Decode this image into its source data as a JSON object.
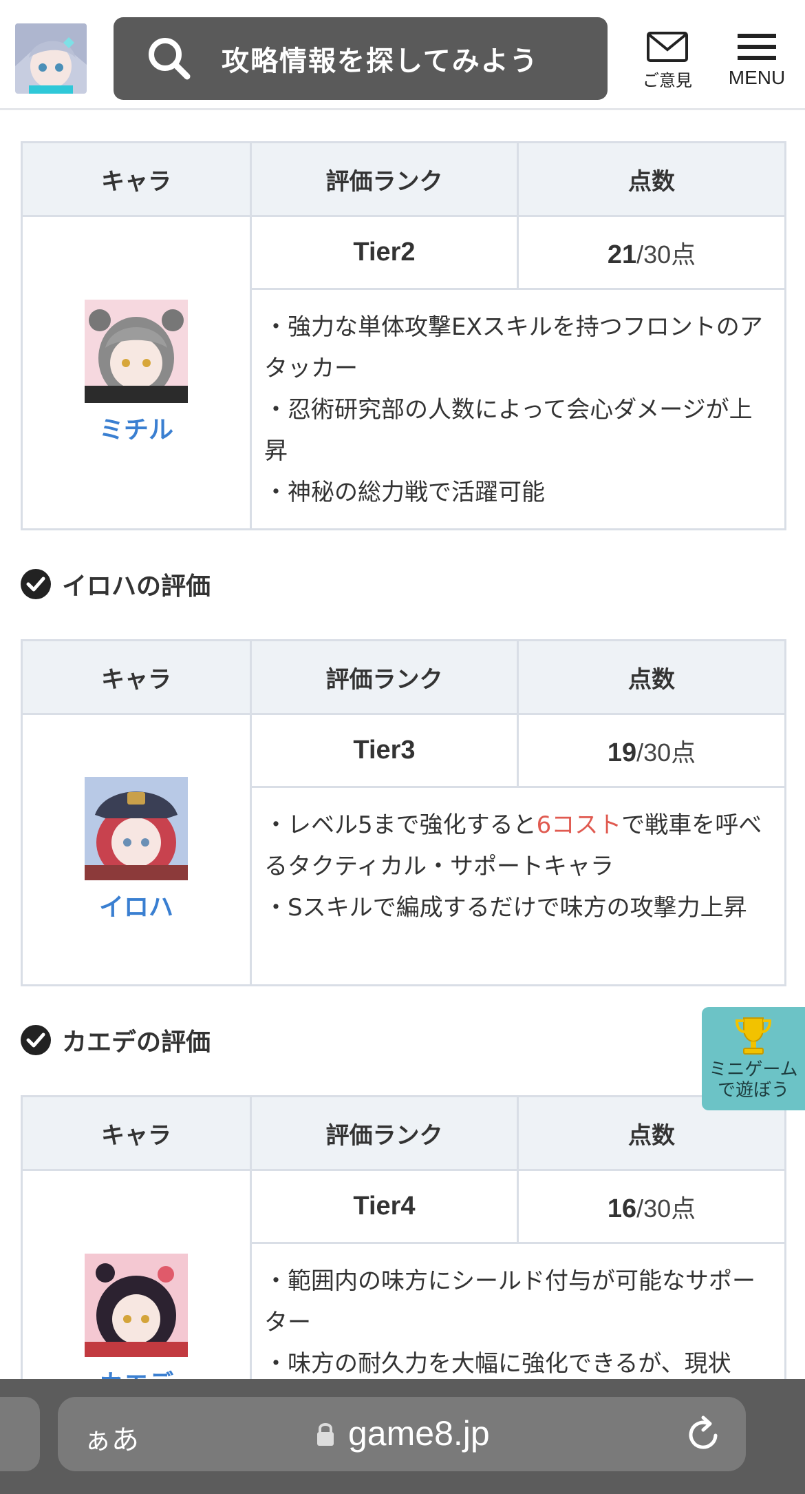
{
  "header": {
    "search_placeholder": "攻略情報を探してみよう",
    "opinion_label": "ご意見",
    "menu_label": "MENU"
  },
  "table_headers": {
    "chara": "キャラ",
    "rank": "評価ランク",
    "score": "点数"
  },
  "score_suffix": "/30点",
  "characters": [
    {
      "name": "ミチル",
      "tier": "Tier2",
      "score": "21",
      "desc": [
        "・強力な単体攻撃EXスキルを持つフロントのアタッカー",
        "・忍術研究部の人数によって会心ダメージが上昇",
        "・神秘の総力戦で活躍可能"
      ]
    },
    {
      "section_title": "イロハの評価",
      "name": "イロハ",
      "tier": "Tier3",
      "score": "19",
      "desc_a1": "・レベル5まで強化すると",
      "desc_a_red": "6コスト",
      "desc_a2": "で戦車を呼べるタクティカル・サポートキャラ",
      "desc_b": "・Sスキルで編成するだけで味方の攻撃力上昇"
    },
    {
      "section_title": "カエデの評価",
      "name": "カエデ",
      "tier": "Tier4",
      "score": "16",
      "desc": [
        "・範囲内の味方にシールド付与が可能なサポーター",
        "・味方の耐久力を大幅に強化できるが、現状"
      ]
    }
  ],
  "minigame": {
    "line1": "ミニゲーム",
    "line2": "で遊ぼう"
  },
  "browser": {
    "aa": "ぁあ",
    "url": "game8.jp"
  },
  "colors": {
    "link": "#3a7fd1",
    "accent_red": "#e05a50",
    "header_bg": "#5a5a5a",
    "minigame_bg": "#6cc3c6"
  }
}
